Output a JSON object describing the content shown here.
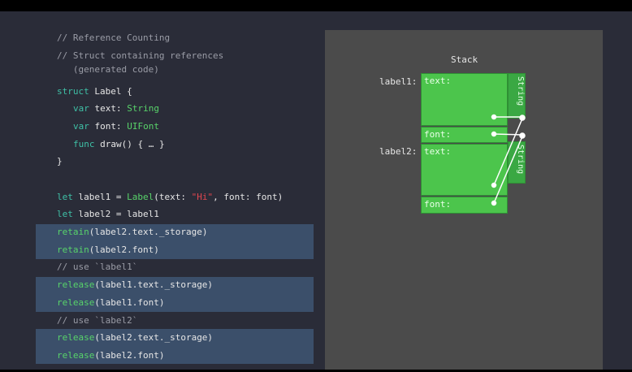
{
  "code": {
    "l1": "// Reference Counting",
    "l2": "// Struct containing references",
    "l3": "   (generated code)",
    "l4a": "struct",
    "l4b": " Label {",
    "l5a": "var",
    "l5b": " text: ",
    "l5c": "String",
    "l6a": "var",
    "l6b": " font: ",
    "l6c": "UIFont",
    "l7a": "func",
    "l7b": " draw() { … }",
    "l8": "}",
    "l9a": "let",
    "l9b": " label1 = ",
    "l9c": "Label",
    "l9d": "(text: ",
    "l9e": "\"Hi\"",
    "l9f": ", font: font)",
    "l10a": "let",
    "l10b": " label2 = label1",
    "l11a": "retain",
    "l11b": "(label2.text._storage)",
    "l12a": "retain",
    "l12b": "(label2.font)",
    "l13": "// use `label1`",
    "l14a": "release",
    "l14b": "(label1.text._storage)",
    "l15a": "release",
    "l15b": "(label1.font)",
    "l16": "// use `label2`",
    "l17a": "release",
    "l17b": "(label2.text._storage)",
    "l18a": "release",
    "l18b": "(label2.font)"
  },
  "diagram": {
    "title": "Stack",
    "label1": "label1:",
    "label2": "label2:",
    "text_field": "text:",
    "font_field": "font:",
    "string_side": "String",
    "colors": {
      "field": "#4cc54c",
      "side": "#3aa843",
      "panel": "#4b4b4b",
      "highlight": "#3b4f6a"
    }
  }
}
